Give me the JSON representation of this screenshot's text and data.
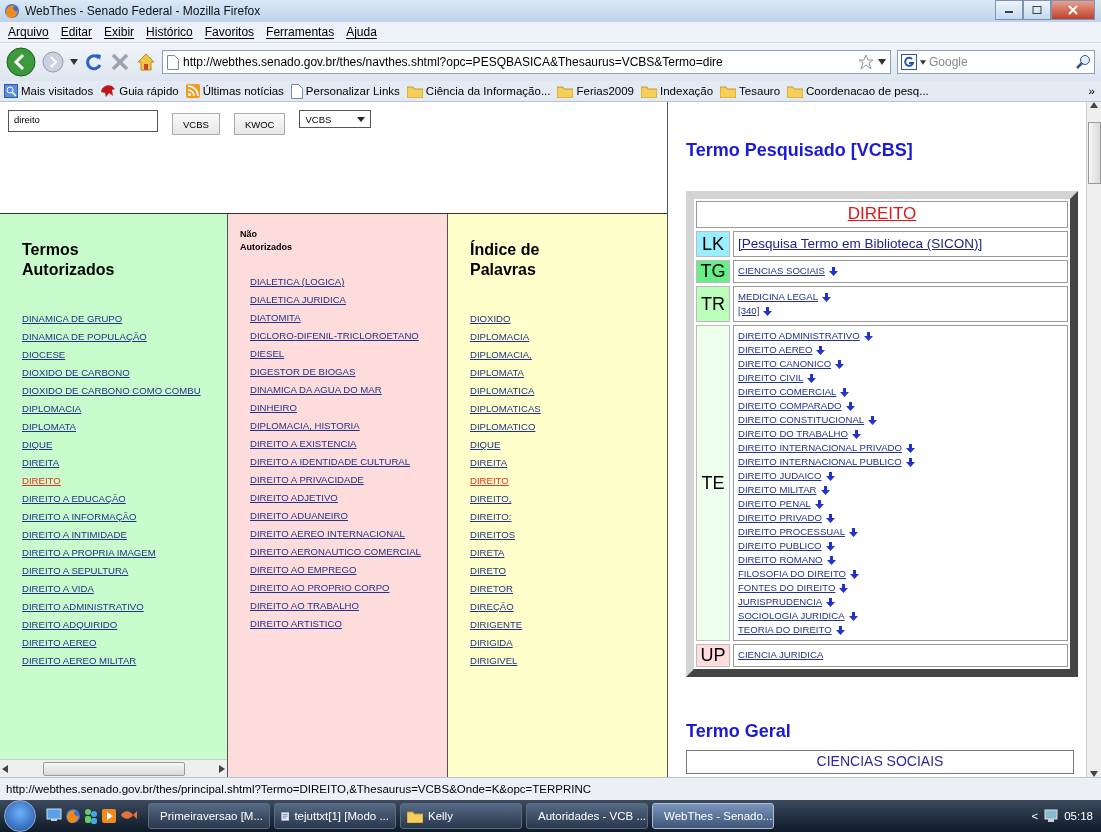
{
  "window": {
    "title": "WebThes - Senado Federal - Mozilla Firefox"
  },
  "menu": [
    "Arquivo",
    "Editar",
    "Exibir",
    "Histórico",
    "Favoritos",
    "Ferramentas",
    "Ajuda"
  ],
  "address_bar": {
    "value": "http://webthes.senado.gov.br/thes/navthes.shtml?opc=PESQBASICA&Thesaurus=VCBS&Termo=dire"
  },
  "search_engine": {
    "placeholder": "Google"
  },
  "bookmarks": [
    {
      "label": "Mais visitados",
      "kind": "smart"
    },
    {
      "label": "Guia rápido",
      "kind": "guide"
    },
    {
      "label": "Últimas notícias",
      "kind": "feed"
    },
    {
      "label": "Personalizar Links",
      "kind": "page"
    },
    {
      "label": "Ciência da Informação...",
      "kind": "folder"
    },
    {
      "label": "Ferias2009",
      "kind": "folder"
    },
    {
      "label": "Indexação",
      "kind": "folder"
    },
    {
      "label": "Tesauro",
      "kind": "folder"
    },
    {
      "label": "Coordenacao de pesq...",
      "kind": "folder"
    }
  ],
  "bookmarks_overflow": "»",
  "search_form": {
    "query": "direito",
    "buttons": [
      "VCBS",
      "KWOC"
    ],
    "thesaurus": "VCBS"
  },
  "columns": [
    {
      "title": "Termos Autorizados",
      "kind": "large",
      "color": "#c8fccc",
      "items": [
        {
          "label": "DINAMICA DE GRUPO",
          "selected": false
        },
        {
          "label": "DINAMICA DE POPULAÇÃO",
          "selected": false
        },
        {
          "label": "DIOCESE",
          "selected": false
        },
        {
          "label": "DIOXIDO DE CARBONO",
          "selected": false
        },
        {
          "label": "DIOXIDO DE CARBONO COMO COMBU",
          "selected": false
        },
        {
          "label": "DIPLOMACIA",
          "selected": false
        },
        {
          "label": "DIPLOMATA",
          "selected": false
        },
        {
          "label": "DIQUE",
          "selected": false
        },
        {
          "label": "DIREITA",
          "selected": false
        },
        {
          "label": "DIREITO",
          "selected": true
        },
        {
          "label": "DIREITO A EDUCAÇÃO",
          "selected": false
        },
        {
          "label": "DIREITO A INFORMAÇÃO",
          "selected": false
        },
        {
          "label": "DIREITO A INTIMIDADE",
          "selected": false
        },
        {
          "label": "DIREITO A PROPRIA IMAGEM",
          "selected": false
        },
        {
          "label": "DIREITO A SEPULTURA",
          "selected": false
        },
        {
          "label": "DIREITO A VIDA",
          "selected": false
        },
        {
          "label": "DIREITO ADMINISTRATIVO",
          "selected": false
        },
        {
          "label": "DIREITO ADQUIRIDO",
          "selected": false
        },
        {
          "label": "DIREITO AEREO",
          "selected": false
        },
        {
          "label": "DIREITO AEREO MILITAR",
          "selected": false
        }
      ]
    },
    {
      "title": "Não Autorizados",
      "kind": "small",
      "color": "#ffdcdc",
      "items": [
        {
          "label": "DIALETICA (LOGICA)",
          "selected": false
        },
        {
          "label": "DIALETICA JURIDICA",
          "selected": false
        },
        {
          "label": "DIATOMITA",
          "selected": false
        },
        {
          "label": "DICLORO-DIFENIL-TRICLOROETANO",
          "selected": false
        },
        {
          "label": "DIESEL",
          "selected": false
        },
        {
          "label": "DIGESTOR DE BIOGAS",
          "selected": false
        },
        {
          "label": "DINAMICA DA AGUA DO MAR",
          "selected": false
        },
        {
          "label": "DINHEIRO",
          "selected": false
        },
        {
          "label": "DIPLOMACIA, HISTORIA",
          "selected": false
        },
        {
          "label": "DIREITO A EXISTENCIA",
          "selected": false
        },
        {
          "label": "DIREITO A IDENTIDADE CULTURAL",
          "selected": false
        },
        {
          "label": "DIREITO A PRIVACIDADE",
          "selected": false
        },
        {
          "label": "DIREITO ADJETIVO",
          "selected": false
        },
        {
          "label": "DIREITO ADUANEIRO",
          "selected": false
        },
        {
          "label": "DIREITO AEREO INTERNACIONAL",
          "selected": false
        },
        {
          "label": "DIREITO AERONAUTICO COMERCIAL",
          "selected": false
        },
        {
          "label": "DIREITO AO EMPREGO",
          "selected": false
        },
        {
          "label": "DIREITO AO PROPRIO CORPO",
          "selected": false
        },
        {
          "label": "DIREITO AO TRABALHO",
          "selected": false
        },
        {
          "label": "DIREITO ARTISTICO",
          "selected": false
        }
      ]
    },
    {
      "title": "Índice de Palavras",
      "kind": "large",
      "color": "#ffffcc",
      "items": [
        {
          "label": "DIOXIDO",
          "selected": false
        },
        {
          "label": "DIPLOMACIA",
          "selected": false
        },
        {
          "label": "DIPLOMACIA,",
          "selected": false
        },
        {
          "label": "DIPLOMATA",
          "selected": false
        },
        {
          "label": "DIPLOMATICA",
          "selected": false
        },
        {
          "label": "DIPLOMATICAS",
          "selected": false
        },
        {
          "label": "DIPLOMATICO",
          "selected": false
        },
        {
          "label": "DIQUE",
          "selected": false
        },
        {
          "label": "DIREITA",
          "selected": false
        },
        {
          "label": "DIREITO",
          "selected": true
        },
        {
          "label": "DIREITO,",
          "selected": false
        },
        {
          "label": "DIREITO:",
          "selected": false
        },
        {
          "label": "DIREITOS",
          "selected": false
        },
        {
          "label": "DIRETA",
          "selected": false
        },
        {
          "label": "DIRETO",
          "selected": false
        },
        {
          "label": "DIRETOR",
          "selected": false
        },
        {
          "label": "DIREÇÃO",
          "selected": false
        },
        {
          "label": "DIRIGENTE",
          "selected": false
        },
        {
          "label": "DIRIGIDA",
          "selected": false
        },
        {
          "label": "DIRIGIVEL",
          "selected": false
        }
      ]
    }
  ],
  "result": {
    "heading": "Termo Pesquisado [VCBS]",
    "term": "DIREITO",
    "relations": [
      {
        "code": "LK",
        "color": "#99eeff",
        "items": [
          {
            "label": "[Pesquisa Termo em Biblioteca (SICON)]",
            "kind": "library",
            "arrow": false
          }
        ]
      },
      {
        "code": "TG",
        "color": "#66ee88",
        "items": [
          {
            "label": "CIENCIAS SOCIAIS",
            "kind": "term",
            "arrow": true
          }
        ]
      },
      {
        "code": "TR",
        "color": "#bbffbb",
        "items": [
          {
            "label": "MEDICINA LEGAL",
            "kind": "term",
            "arrow": true
          },
          {
            "label": "[340]",
            "kind": "term",
            "arrow": true
          }
        ]
      },
      {
        "code": "TE",
        "color": "#eeffee",
        "items": [
          {
            "label": "DIREITO ADMINISTRATIVO",
            "kind": "term",
            "arrow": true
          },
          {
            "label": "DIREITO AEREO",
            "kind": "term",
            "arrow": true
          },
          {
            "label": "DIREITO CANONICO",
            "kind": "term",
            "arrow": true
          },
          {
            "label": "DIREITO CIVIL",
            "kind": "term",
            "arrow": true
          },
          {
            "label": "DIREITO COMERCIAL",
            "kind": "term",
            "arrow": true
          },
          {
            "label": "DIREITO COMPARADO",
            "kind": "term",
            "arrow": true
          },
          {
            "label": "DIREITO CONSTITUCIONAL",
            "kind": "term",
            "arrow": true
          },
          {
            "label": "DIREITO DO TRABALHO",
            "kind": "term",
            "arrow": true
          },
          {
            "label": "DIREITO INTERNACIONAL PRIVADO",
            "kind": "term",
            "arrow": true
          },
          {
            "label": "DIREITO INTERNACIONAL PUBLICO",
            "kind": "term",
            "arrow": true
          },
          {
            "label": "DIREITO JUDAICO",
            "kind": "term",
            "arrow": true
          },
          {
            "label": "DIREITO MILITAR",
            "kind": "term",
            "arrow": true
          },
          {
            "label": "DIREITO PENAL",
            "kind": "term",
            "arrow": true
          },
          {
            "label": "DIREITO PRIVADO",
            "kind": "term",
            "arrow": true
          },
          {
            "label": "DIREITO PROCESSUAL",
            "kind": "term",
            "arrow": true
          },
          {
            "label": "DIREITO PUBLICO",
            "kind": "term",
            "arrow": true
          },
          {
            "label": "DIREITO ROMANO",
            "kind": "term",
            "arrow": true
          },
          {
            "label": "FILOSOFIA DO DIREITO",
            "kind": "term",
            "arrow": true
          },
          {
            "label": "FONTES DO DIREITO",
            "kind": "term",
            "arrow": true
          },
          {
            "label": "JURISPRUDENCIA",
            "kind": "term",
            "arrow": true
          },
          {
            "label": "SOCIOLOGIA JURIDICA",
            "kind": "term",
            "arrow": true
          },
          {
            "label": "TEORIA DO DIREITO",
            "kind": "term",
            "arrow": true
          }
        ]
      },
      {
        "code": "UP",
        "color": "#ffdddd",
        "items": [
          {
            "label": "CIENCIA JURIDICA",
            "kind": "term",
            "arrow": false
          }
        ]
      }
    ]
  },
  "next_section": {
    "heading": "Termo Geral",
    "term": "CIENCIAS SOCIAIS"
  },
  "status_bar": {
    "text": "http://webthes.senado.gov.br/thes/principal.shtml?Termo=DIREITO,&Thesaurus=VCBS&Onde=K&opc=TERPRINC"
  },
  "taskbar": {
    "tasks": [
      {
        "label": "Primeiraversao [M...",
        "kind": "document",
        "selected": false
      },
      {
        "label": "tejuttxt[1] [Modo ...",
        "kind": "document",
        "selected": false
      },
      {
        "label": "Kelly",
        "kind": "folder",
        "selected": false
      },
      {
        "label": "Autoridades - VCB ...",
        "kind": "browser",
        "selected": false
      },
      {
        "label": "WebThes - Senado...",
        "kind": "browser",
        "selected": true
      }
    ],
    "tray_toggle": "<",
    "clock": "05:18"
  }
}
